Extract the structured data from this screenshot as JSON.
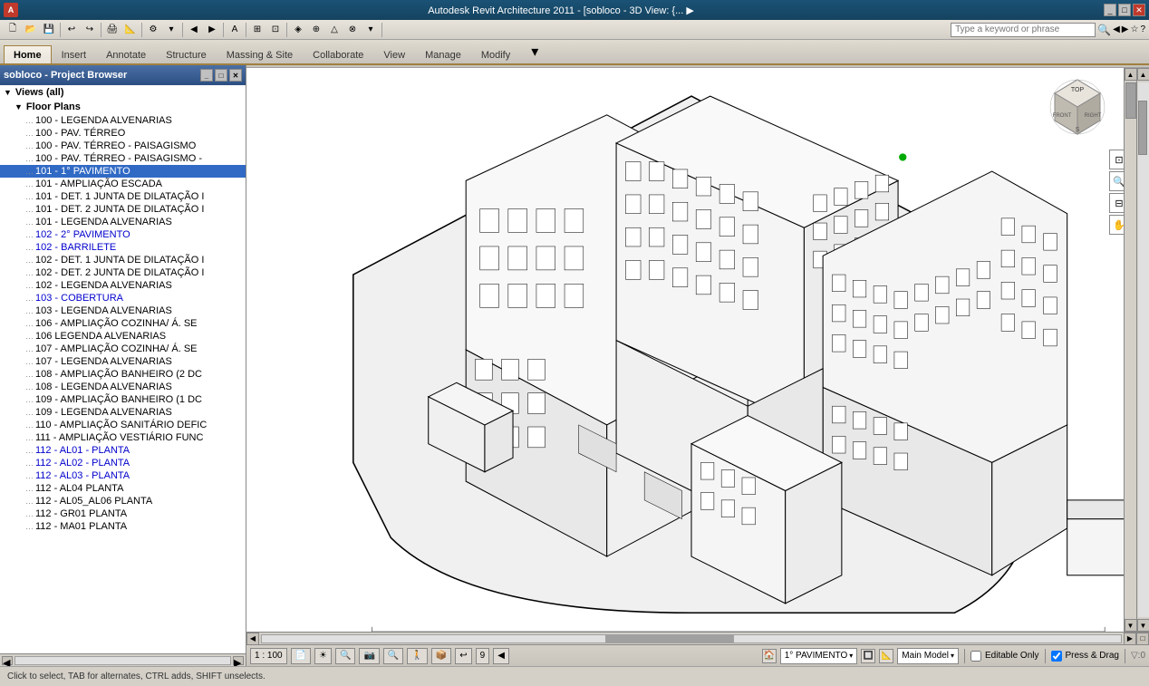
{
  "titlebar": {
    "title": "Autodesk Revit Architecture 2011 - [sobloco - 3D View: {... ▶",
    "search_placeholder": "Type a keyword or phrase"
  },
  "ribbon": {
    "tabs": [
      "Home",
      "Insert",
      "Annotate",
      "Structure",
      "Massing & Site",
      "Collaborate",
      "View",
      "Manage",
      "Modify"
    ],
    "active_tab": "Home",
    "dropdown_arrow": "▾"
  },
  "project_browser": {
    "title": "sobloco - Project Browser",
    "tree_items": [
      {
        "label": "Views (all)",
        "type": "section",
        "indent": 0
      },
      {
        "label": "Floor Plans",
        "type": "section",
        "indent": 1
      },
      {
        "label": "100 - LEGENDA ALVENARIAS",
        "type": "item",
        "indent": 2
      },
      {
        "label": "100 - PAV. TÉRREO",
        "type": "item",
        "indent": 2,
        "selected": false
      },
      {
        "label": "100 - PAV. TÉRREO - PAISAGISMO",
        "type": "item",
        "indent": 2
      },
      {
        "label": "100 - PAV. TÉRREO - PAISAGISMO -",
        "type": "item",
        "indent": 2
      },
      {
        "label": "101 - 1° PAVIMENTO",
        "type": "item",
        "indent": 2,
        "selected": true
      },
      {
        "label": "101 - AMPLIAÇÃO ESCADA",
        "type": "item",
        "indent": 2
      },
      {
        "label": "101 - DET. 1 JUNTA DE DILATAÇÃO 1",
        "type": "item",
        "indent": 2
      },
      {
        "label": "101 - DET. 2 JUNTA DE DILATAÇÃO 1",
        "type": "item",
        "indent": 2
      },
      {
        "label": "101 - LEGENDA ALVENARIAS",
        "type": "item",
        "indent": 2
      },
      {
        "label": "102 - 2° PAVIMENTO",
        "type": "item",
        "indent": 2
      },
      {
        "label": "102 - BARRILETE",
        "type": "item",
        "indent": 2
      },
      {
        "label": "102 - DET. 1 JUNTA DE DILATAÇÃO 1",
        "type": "item",
        "indent": 2
      },
      {
        "label": "102 - DET. 2 JUNTA DE DILATAÇÃO 1",
        "type": "item",
        "indent": 2
      },
      {
        "label": "102 - LEGENDA ALVENARIAS",
        "type": "item",
        "indent": 2
      },
      {
        "label": "103 - COBERTURA",
        "type": "item",
        "indent": 2
      },
      {
        "label": "103 - LEGENDA ALVENARIAS",
        "type": "item",
        "indent": 2
      },
      {
        "label": "106 - AMPLIAÇÃO COZINHA/ Á. SE",
        "type": "item",
        "indent": 2
      },
      {
        "label": "106 LEGENDA ALVENARIAS",
        "type": "item",
        "indent": 2
      },
      {
        "label": "107 - AMPLIAÇÃO COZINHA/ Á. SE",
        "type": "item",
        "indent": 2
      },
      {
        "label": "107 - LEGENDA ALVENARIAS",
        "type": "item",
        "indent": 2
      },
      {
        "label": "108 - AMPLIAÇÃO BANHEIRO (2 DC",
        "type": "item",
        "indent": 2
      },
      {
        "label": "108 - LEGENDA ALVENARIAS",
        "type": "item",
        "indent": 2
      },
      {
        "label": "109 - AMPLIAÇÃO BANHEIRO (1 DC",
        "type": "item",
        "indent": 2
      },
      {
        "label": "109 - LEGENDA ALVENARIAS",
        "type": "item",
        "indent": 2
      },
      {
        "label": "110 - AMPLIAÇÃO SANITÁRIO DEFIC",
        "type": "item",
        "indent": 2
      },
      {
        "label": "111 - AMPLIAÇÃO VESTIÁRIO FUNC",
        "type": "item",
        "indent": 2
      },
      {
        "label": "112 - AL01 - PLANTA",
        "type": "item",
        "indent": 2
      },
      {
        "label": "112 - AL02 - PLANTA",
        "type": "item",
        "indent": 2
      },
      {
        "label": "112 - AL03 - PLANTA",
        "type": "item",
        "indent": 2
      },
      {
        "label": "112 - AL04 PLANTA",
        "type": "item",
        "indent": 2
      },
      {
        "label": "112 - AL05_AL06 PLANTA",
        "type": "item",
        "indent": 2
      },
      {
        "label": "112 - GR01 PLANTA",
        "type": "item",
        "indent": 2
      },
      {
        "label": "112 - MA01 PLANTA",
        "type": "item",
        "indent": 2
      }
    ]
  },
  "bottom_toolbar": {
    "scale": "1 : 100",
    "icons": [
      "📄",
      "⚡",
      "🔍",
      "🔍",
      "🔍",
      "📐",
      "📦",
      "↩",
      "9"
    ],
    "active_floor": "1° PAVIMENTO",
    "main_model": "Main Model",
    "editable_only": "Editable Only",
    "press_drag": "Press & Drag",
    "filter": "▽:0"
  },
  "status_bar": {
    "message": "Click to select, TAB for alternates, CTRL adds, SHIFT unselects."
  },
  "view_cube": {
    "top": "TOP",
    "front": "FRONT",
    "right": "RIGHT",
    "south": "S"
  },
  "colors": {
    "ribbon_accent": "#a08040",
    "title_bg": "#1a5276",
    "pb_title_bg": "#4a6fa5",
    "selected_blue": "#316AC5"
  }
}
